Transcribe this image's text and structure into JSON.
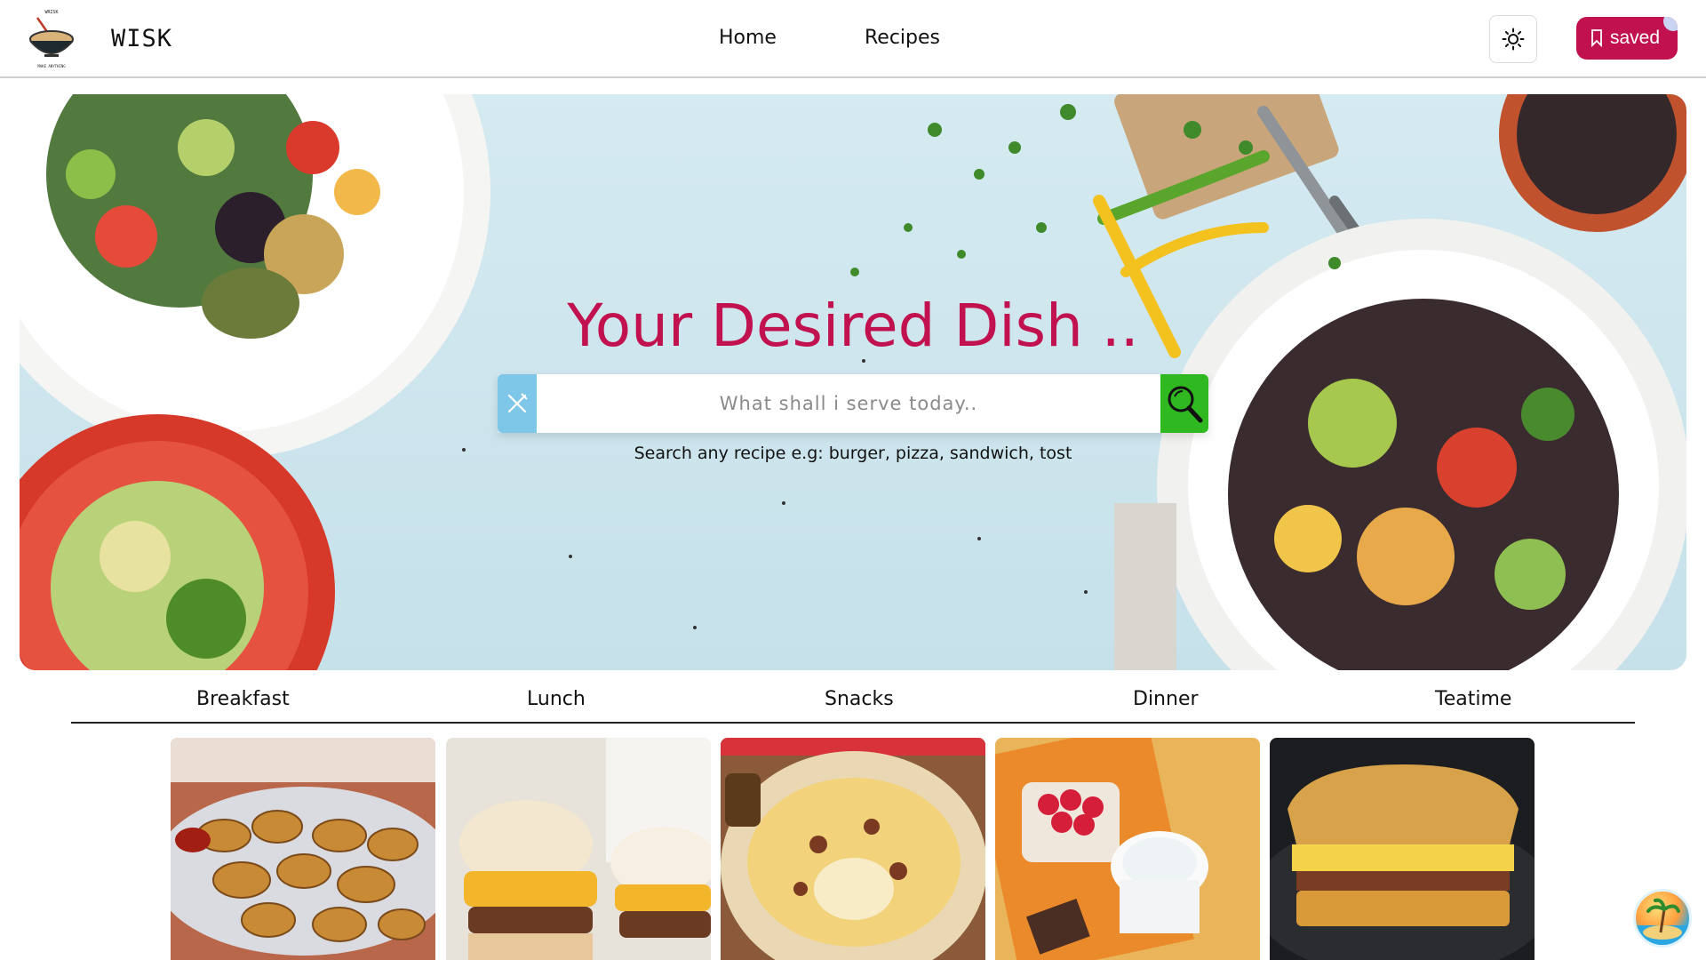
{
  "header": {
    "brand": "WISK",
    "logo_top_text": "WRISK",
    "logo_bottom_text": "MAKE ANYTHING",
    "nav": {
      "home": "Home",
      "recipes": "Recipes"
    },
    "theme_icon": "sun-icon",
    "saved_label": "saved",
    "saved_icon": "bookmark-icon",
    "accent_color": "#c1124f"
  },
  "hero": {
    "title": "Your Desired Dish ..",
    "search": {
      "placeholder": "What shall i serve today..",
      "left_icon": "utensils-icon",
      "button_icon": "search-icon"
    },
    "hint": "Search any recipe e.g: burger, pizza, sandwich, tost"
  },
  "categories": [
    "Breakfast",
    "Lunch",
    "Snacks",
    "Dinner",
    "Teatime"
  ],
  "cards": [
    {
      "subject": "croissant-rolls"
    },
    {
      "subject": "breakfast-sliders"
    },
    {
      "subject": "breakfast-tortilla"
    },
    {
      "subject": "berries-and-yogurt"
    },
    {
      "subject": "grilled-sandwich"
    }
  ],
  "chat_widget_icon": "beach-icon"
}
